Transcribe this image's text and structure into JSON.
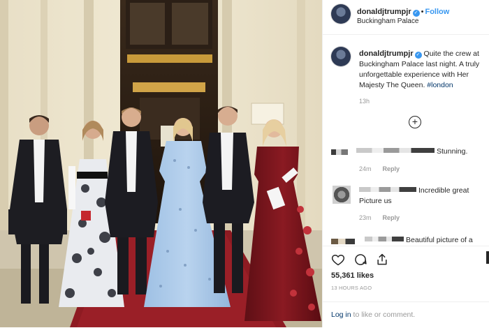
{
  "post": {
    "username": "donaldjtrumpjr",
    "verified_icon": "verified-badge-icon",
    "dot": "•",
    "follow_label": "Follow",
    "location": "Buckingham Palace",
    "caption_main": "Quite the crew at Buckingham Palace last night. A truly unforgettable experience with Her Majesty The Queen.",
    "caption_hashtag": "#london",
    "caption_age": "13h",
    "load_more_icon": "plus-circle-icon",
    "comments": [
      {
        "text": "Stunning.",
        "age": "24m",
        "reply_label": "Reply"
      },
      {
        "text": "Incredible great Picture us",
        "age": "23m",
        "reply_label": "Reply"
      },
      {
        "text": "Beautiful picture of a"
      }
    ],
    "actions": {
      "like_icon": "heart-icon",
      "comment_icon": "comment-icon",
      "share_icon": "share-icon"
    },
    "likes": "55,361 likes",
    "timestamp": "13 HOURS AGO",
    "login": {
      "link_label": "Log in",
      "suffix": " to like or comment."
    }
  },
  "colors": {
    "link_blue": "#3897f0",
    "hashtag": "#003569",
    "muted": "#999999",
    "text": "#262626"
  }
}
